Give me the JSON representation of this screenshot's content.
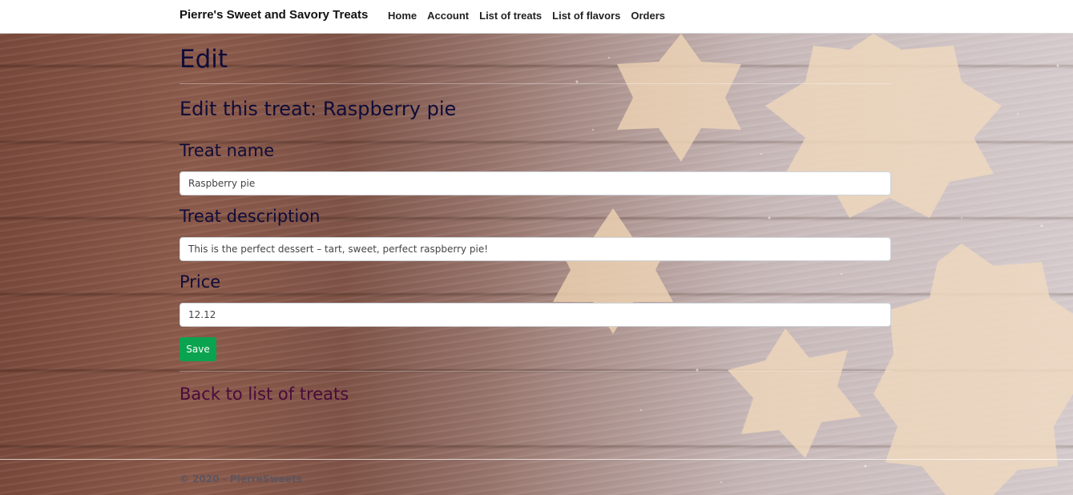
{
  "navbar": {
    "brand": "Pierre's Sweet and Savory Treats",
    "links": [
      "Home",
      "Account",
      "List of treats",
      "List of flavors",
      "Orders"
    ]
  },
  "page": {
    "title": "Edit",
    "subtitle": "Edit this treat: Raspberry pie"
  },
  "form": {
    "name_label": "Treat name",
    "name_value": "Raspberry pie",
    "description_label": "Treat description",
    "description_value": "This is the perfect dessert – tart, sweet, perfect raspberry pie!",
    "price_label": "Price",
    "price_value": "12.12",
    "save_label": "Save"
  },
  "back_link": "Back to list of treats",
  "footer": "© 2020 - PierreSweets",
  "colors": {
    "heading": "#0f0c3a",
    "save_button": "#0aa34f",
    "link": "#4a0a3c"
  },
  "icons": {
    "background": "wooden-table-with-star-cookies-and-powdered-sugar"
  }
}
